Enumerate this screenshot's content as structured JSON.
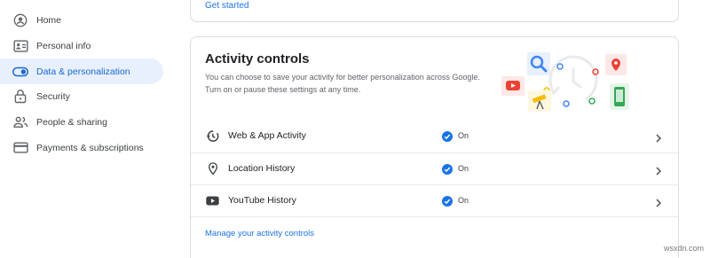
{
  "sidebar": {
    "items": [
      {
        "label": "Home",
        "icon": "account-circle-icon",
        "active": false
      },
      {
        "label": "Personal info",
        "icon": "id-card-icon",
        "active": false
      },
      {
        "label": "Data & personalization",
        "icon": "toggle-icon",
        "active": true
      },
      {
        "label": "Security",
        "icon": "lock-icon",
        "active": false
      },
      {
        "label": "People & sharing",
        "icon": "people-icon",
        "active": false
      },
      {
        "label": "Payments & subscriptions",
        "icon": "credit-card-icon",
        "active": false
      }
    ]
  },
  "top_card": {
    "link": "Get started"
  },
  "activity_controls": {
    "title": "Activity controls",
    "description": "You can choose to save your activity for better personalization across Google. Turn on or pause these settings at any time.",
    "rows": [
      {
        "label": "Web & App Activity",
        "status": "On",
        "icon": "history-icon"
      },
      {
        "label": "Location History",
        "status": "On",
        "icon": "location-pin-icon"
      },
      {
        "label": "YouTube History",
        "status": "On",
        "icon": "youtube-icon"
      }
    ],
    "manage_link": "Manage your activity controls"
  },
  "watermark": "wsxdn.com",
  "colors": {
    "accent": "#1a73e8",
    "active_bg": "#e8f0fe",
    "border": "#dadce0",
    "check": "#1a73e8"
  }
}
